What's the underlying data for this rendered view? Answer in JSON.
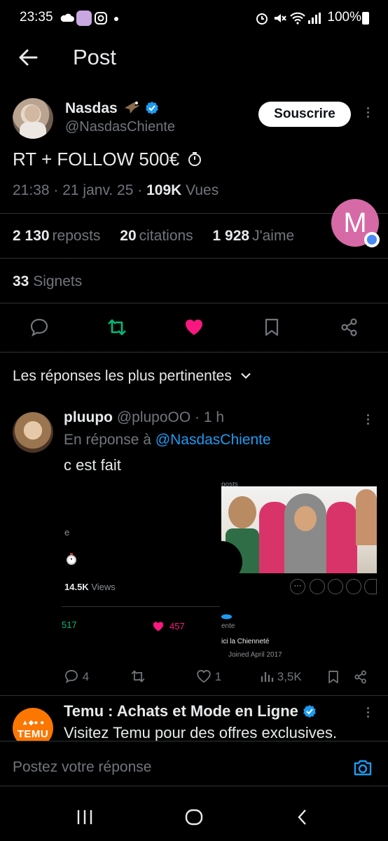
{
  "status_bar": {
    "time": "23:35",
    "battery": "100%",
    "icons": [
      "cloud-icon",
      "notification-avatar-icon",
      "instagram-icon",
      "dot-icon",
      "alarm-icon",
      "mute-icon",
      "wifi-icon",
      "signal-icon",
      "battery-icon"
    ]
  },
  "header": {
    "title": "Post"
  },
  "post": {
    "author_name": "Nasdas",
    "author_handle": "@NasdasChiente",
    "subscribe_label": "Souscrire",
    "text": "RT + FOLLOW 500€",
    "time": "21:38",
    "date": "21 janv. 25",
    "views_count": "109K",
    "views_label": "Vues",
    "stats": {
      "reposts_count": "2 130",
      "reposts_label": "reposts",
      "quotes_count": "20",
      "quotes_label": "citations",
      "likes_count": "1 928",
      "likes_label": "J'aime",
      "bookmarks_count": "33",
      "bookmarks_label": "Signets"
    }
  },
  "floating_avatar": {
    "letter": "M"
  },
  "replies": {
    "sort_label": "Les réponses les plus pertinentes",
    "items": [
      {
        "name": "pluupo",
        "handle": "@plupoOO",
        "time": "1 h",
        "context_prefix": "En réponse à",
        "context_handle": "@NasdasChiente",
        "text": "c est fait",
        "media": {
          "left_views": "14.5K",
          "left_views_label": "Views",
          "left_reposts": "517",
          "left_likes": "457",
          "left_letter": "e",
          "right_top_text": "posts",
          "right_name_fragment": "ente",
          "right_bio": "ici la Chienneté",
          "right_joined": "Joined April 2017"
        },
        "actions": {
          "replies": "4",
          "reposts": "",
          "likes": "1",
          "views": "3,5K"
        }
      }
    ]
  },
  "ad": {
    "name": "Temu : Achats et Mode en Ligne",
    "text": "Visitez Temu pour des offres exclusives.",
    "logo_text": "TEMU"
  },
  "composer": {
    "placeholder": "Postez votre réponse"
  },
  "colors": {
    "background": "#000000",
    "text": "#e7e9ea",
    "muted": "#71767b",
    "accent": "#1d9bf0",
    "like": "#f91880",
    "repost": "#00ba7c"
  }
}
